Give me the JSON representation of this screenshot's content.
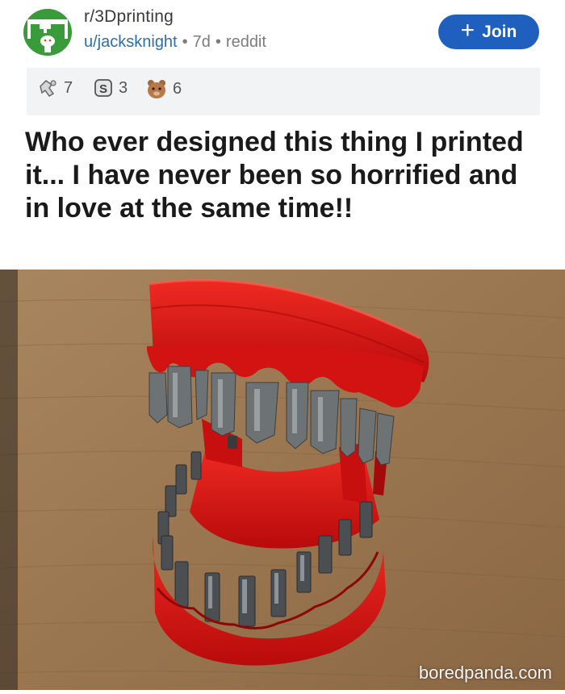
{
  "post": {
    "subreddit": "r/3Dprinting",
    "username": "u/jacksknight",
    "age": "7d",
    "source": "reddit",
    "separator": "•",
    "join_icon": "plus-icon",
    "join_label": "Join",
    "awards": [
      {
        "icon": "awesome-answer-award-icon",
        "count": "7"
      },
      {
        "icon": "silver-award-icon",
        "count": "3"
      },
      {
        "icon": "wholesome-award-icon",
        "count": "6"
      }
    ],
    "title": "Who ever designed this thing I printed it... I have never been so horrified and in love at the same time!!"
  },
  "image": {
    "subject": "red 3D-printed chattering teeth holding screwdriver bits on a wooden table",
    "watermark": "boredpanda.com"
  },
  "colors": {
    "join_button": "#1f5fbe",
    "username": "#2d6fa8",
    "avatar": "#3a9b3a",
    "award_bar": "#f2f3f5",
    "print_red": "#d81414"
  }
}
